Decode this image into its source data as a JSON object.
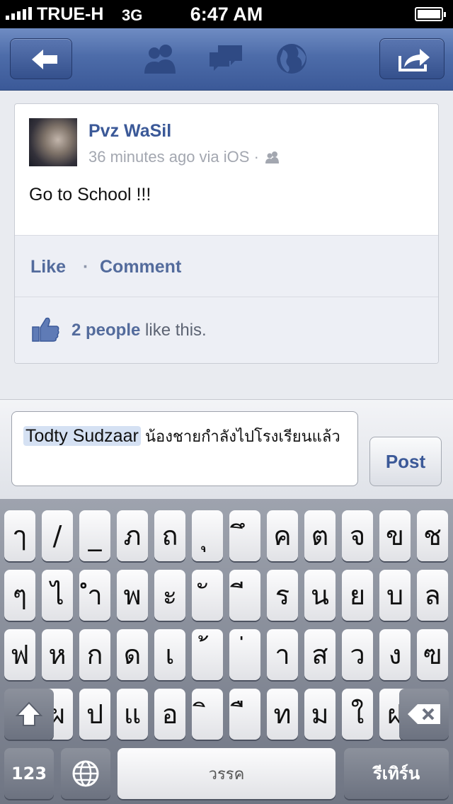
{
  "status_bar": {
    "carrier": "TRUE-H",
    "network": "3G",
    "time": "6:47 AM"
  },
  "nav": {
    "icons": [
      "back-arrow-icon",
      "friends-icon",
      "messages-icon",
      "globe-icon",
      "share-icon"
    ]
  },
  "post": {
    "author": "Pvz WaSil",
    "meta": "36 minutes ago via iOS ·",
    "text": "Go to School !!!",
    "like_label": "Like",
    "separator": "·",
    "comment_label": "Comment",
    "likes_count": "2 people",
    "likes_suffix": " like this."
  },
  "composer": {
    "mention": "Todty Sudzaar",
    "text": " น้องชายกำลังไปโรงเรียนแล้ว",
    "post_label": "Post"
  },
  "keyboard": {
    "row1": [
      "ๅ",
      "/",
      "_",
      "ภ",
      "ถ",
      "ุ",
      "ึ",
      "ค",
      "ต",
      "จ",
      "ข",
      "ช"
    ],
    "row2": [
      "ๆ",
      "ไ",
      "ำ",
      "พ",
      "ะ",
      "ั",
      "ี",
      "ร",
      "น",
      "ย",
      "บ",
      "ล"
    ],
    "row3": [
      "ฟ",
      "ห",
      "ก",
      "ด",
      "เ",
      "้",
      "่",
      "า",
      "ส",
      "ว",
      "ง",
      "ฃ"
    ],
    "row4": [
      "ผ",
      "ป",
      "แ",
      "อ",
      "ิ",
      "ื",
      "ท",
      "ม",
      "ใ",
      "ฝ"
    ],
    "numbers_label": "123",
    "space_label": "วรรค",
    "return_label": "รีเทิร์น"
  },
  "colors": {
    "brand": "#3b5998",
    "link": "#536b9c"
  }
}
